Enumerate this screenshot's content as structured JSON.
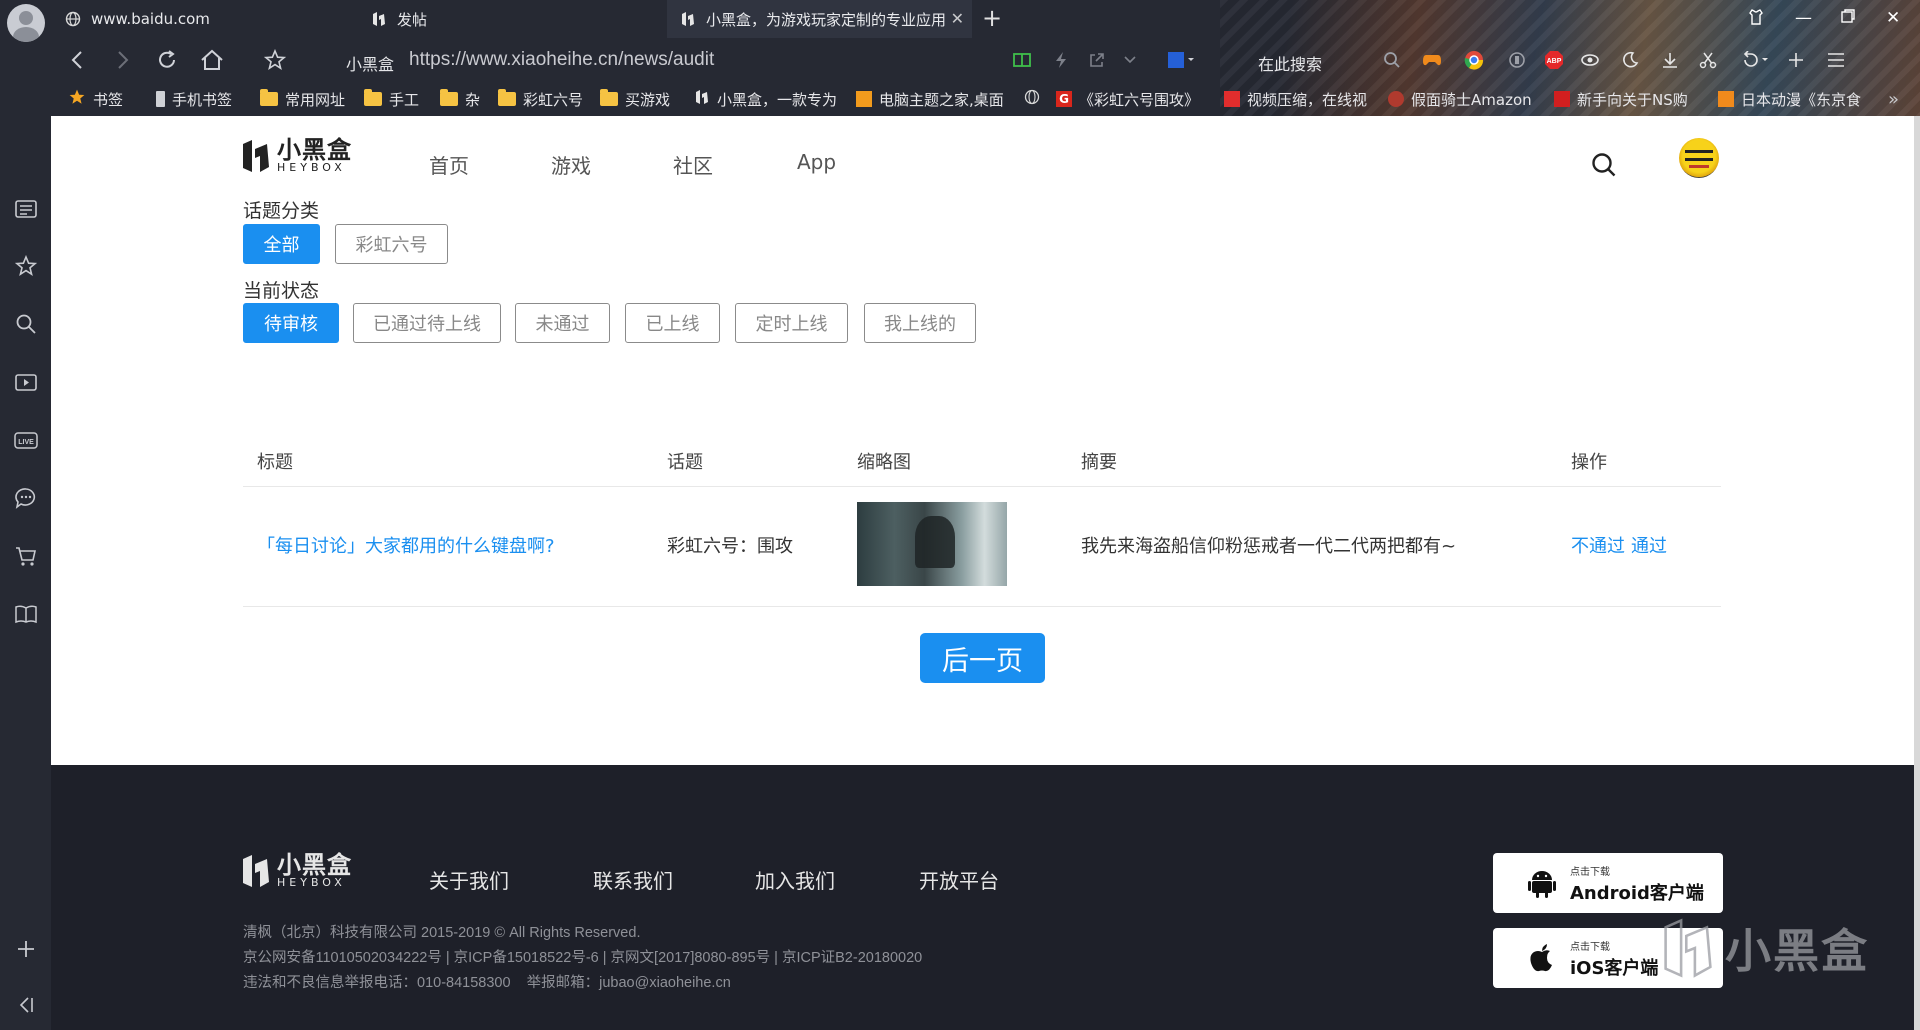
{
  "browser": {
    "tabs": [
      {
        "label": "www.baidu.com",
        "active": false
      },
      {
        "label": "发帖",
        "active": false
      },
      {
        "label": "小黑盒，为游戏玩家定制的专业应用",
        "active": true
      }
    ],
    "address": {
      "site_name": "小黑盒",
      "url": "https://www.xiaoheihe.cn/news/audit"
    },
    "search_label": "在此搜索",
    "bookmarks": [
      "书签",
      "手机书签",
      "常用网址",
      "手工",
      "杂",
      "彩虹六号",
      "买游戏",
      "小黑盒，一款专为",
      "电脑主题之家,桌面",
      "《彩虹六号围攻》",
      "视频压缩，在线视",
      "假面骑士Amazon",
      "新手向关于NS购",
      "日本动漫《东京食"
    ],
    "bookmarks_more": "»"
  },
  "site": {
    "logo_cn": "小黑盒",
    "logo_en": "HEYBOX",
    "nav": [
      "首页",
      "游戏",
      "社区",
      "App"
    ]
  },
  "filters": {
    "topic_title": "话题分类",
    "topics": [
      "全部",
      "彩虹六号"
    ],
    "status_title": "当前状态",
    "statuses": [
      "待审核",
      "已通过待上线",
      "未通过",
      "已上线",
      "定时上线",
      "我上线的"
    ]
  },
  "table": {
    "headers": [
      "标题",
      "话题",
      "缩略图",
      "摘要",
      "操作"
    ],
    "rows": [
      {
        "title": "「每日讨论」大家都用的什么键盘啊?",
        "topic": "彩虹六号：围攻",
        "summary": "我先来海盗船信仰粉惩戒者一代二代两把都有~",
        "reject": "不通过",
        "approve": "通过"
      }
    ]
  },
  "pagination": {
    "next": "后一页"
  },
  "footer": {
    "links": [
      "关于我们",
      "联系我们",
      "加入我们",
      "开放平台"
    ],
    "copyright": "清枫（北京）科技有限公司 2015-2019 © All Rights Reserved.",
    "license": "京公网安备11010502034222号 | 京ICP备15018522号-6 | 京网文[2017]8080-895号 | 京ICP证B2-20180020",
    "report": "违法和不良信息举报电话：010-84158300    举报邮箱：jubao@xiaoheihe.cn",
    "android_small": "点击下载",
    "android_big": "Android客户端",
    "ios_small": "点击下载",
    "ios_big": "iOS客户端",
    "watermark": "小黑盒"
  },
  "colors": {
    "accent": "#1a8ff0",
    "chrome": "#262933",
    "footer_bg": "#1e2029"
  }
}
